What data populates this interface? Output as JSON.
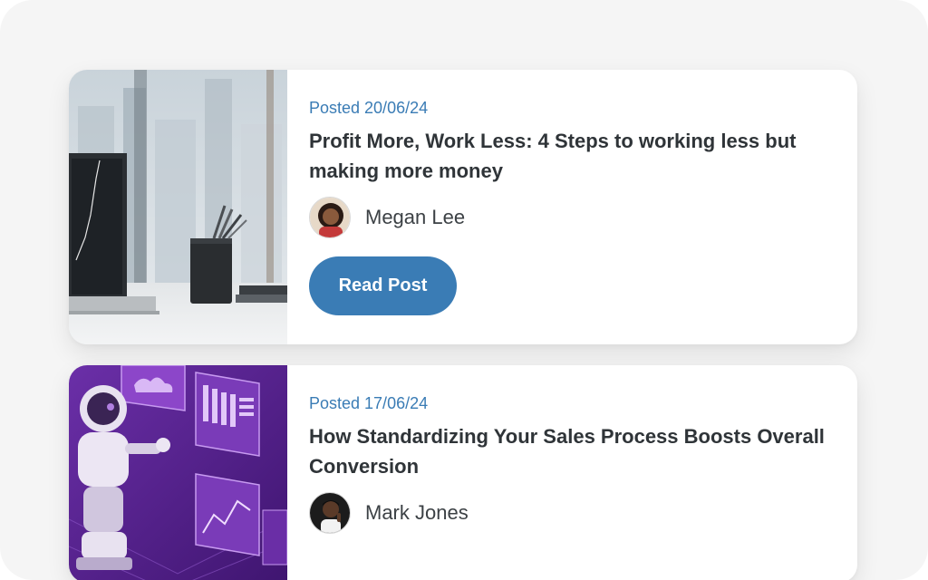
{
  "posts": [
    {
      "date": "Posted 20/06/24",
      "title": "Profit More, Work Less: 4 Steps to working less but making more money",
      "author": "Megan Lee",
      "button_label": "Read Post",
      "image_icon": "office-desk-image"
    },
    {
      "date": "Posted 17/06/24",
      "title": "How Standardizing Your Sales Process Boosts Overall Conversion",
      "author": "Mark Jones",
      "image_icon": "robot-dashboard-image"
    }
  ],
  "colors": {
    "accent": "#3a7cb5",
    "title_text": "#2f3438",
    "background": "#f5f5f5",
    "card": "#ffffff"
  }
}
